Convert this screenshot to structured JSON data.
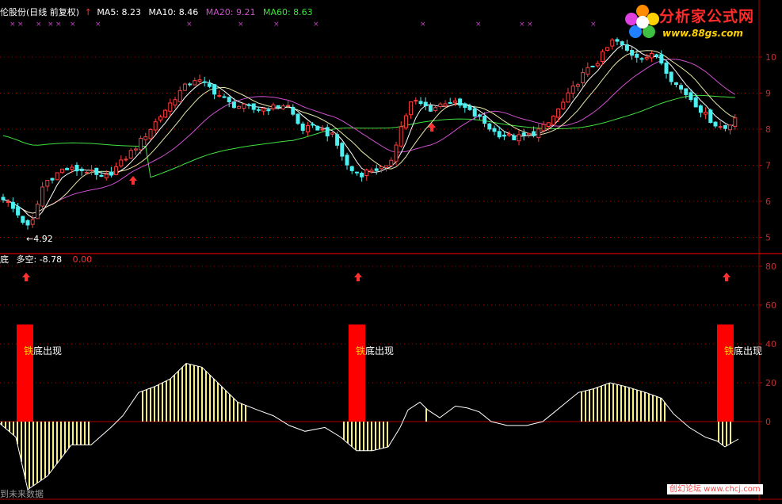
{
  "main_panel": {
    "title": "伦股份(日线 前复权)",
    "indicators": [
      {
        "label": "MA5: 8.23",
        "color": "#ffffff"
      },
      {
        "label": "MA10: 8.46",
        "color": "#ffffff"
      },
      {
        "label": "MA20: 9.21",
        "color": "#d050d0"
      },
      {
        "label": "MA60: 8.63",
        "color": "#40e040"
      }
    ],
    "low_marker": "4.92",
    "y_ticks": [
      "10",
      "9",
      "8",
      "7",
      "6",
      "5"
    ]
  },
  "indicator_panel": {
    "name": "底",
    "metric_label": "多空: -8.78",
    "metric_extra": "0.00",
    "signal_labels": [
      "铁底出现",
      "铁底出现",
      "铁底出现"
    ],
    "y_ticks": [
      "80",
      "60",
      "40",
      "20",
      "0"
    ]
  },
  "watermarks": {
    "logo_text": "分析家公式网",
    "logo_url": "www.88gs.com",
    "bottom_text": "创幻论坛 www.chcj.com"
  },
  "status": "到未来数据",
  "colors": {
    "up": "#ff3c3c",
    "down": "#4cf0f0",
    "ma5": "#ffffff",
    "ma10": "#e8e8a8",
    "ma20": "#d050d0",
    "ma60": "#40e040",
    "grid": "#b00000",
    "histogram": "#f8f080",
    "signal": "#ff0000"
  }
}
